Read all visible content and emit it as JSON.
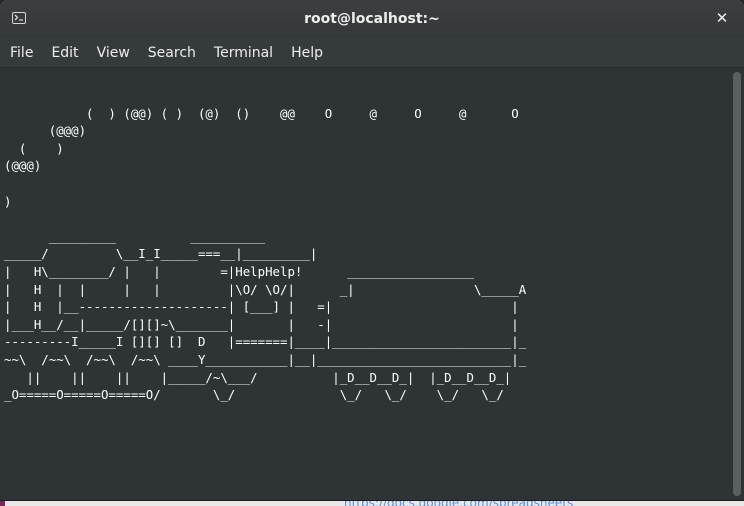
{
  "window": {
    "title": "root@localhost:~",
    "close_label": "✕"
  },
  "menubar": {
    "items": [
      "File",
      "Edit",
      "View",
      "Search",
      "Terminal",
      "Help"
    ]
  },
  "terminal": {
    "output": "\n           (  ) (@@) ( )  (@)  ()    @@    O     @     O     @      O\n      (@@@)\n  (    )\n(@@@)\n\n)\n\n      _________          __________\n_____/         \\__I_I_____===__|_________|\n|   H\\________/ |   |        =|HelpHelp!      _________________\n|   H  |  |     |   |         |\\O/ \\O/|      _|                \\_____A\n|   H  |__--------------------| [___] |   =|                        |\n|___H__/__|_____/[][]~\\_______|       |   -|                        |\n---------I_____I [][] []  D   |=======|____|________________________|_\n~~\\  /~~\\  /~~\\  /~~\\ ____Y___________|__|__________________________|_\n   ||    ||    ||    |_____/~\\___/          |_D__D__D_|  |_D__D__D_|\n_O=====O=====O=====O/       \\_/              \\_/   \\_/    \\_/   \\_/"
  },
  "background": {
    "link_text": "https://docs.google.com/spreadsheets"
  },
  "colors": {
    "terminal_bg": "#2e3436",
    "terminal_fg": "#ffffff",
    "titlebar_bg": "#383c3e"
  }
}
